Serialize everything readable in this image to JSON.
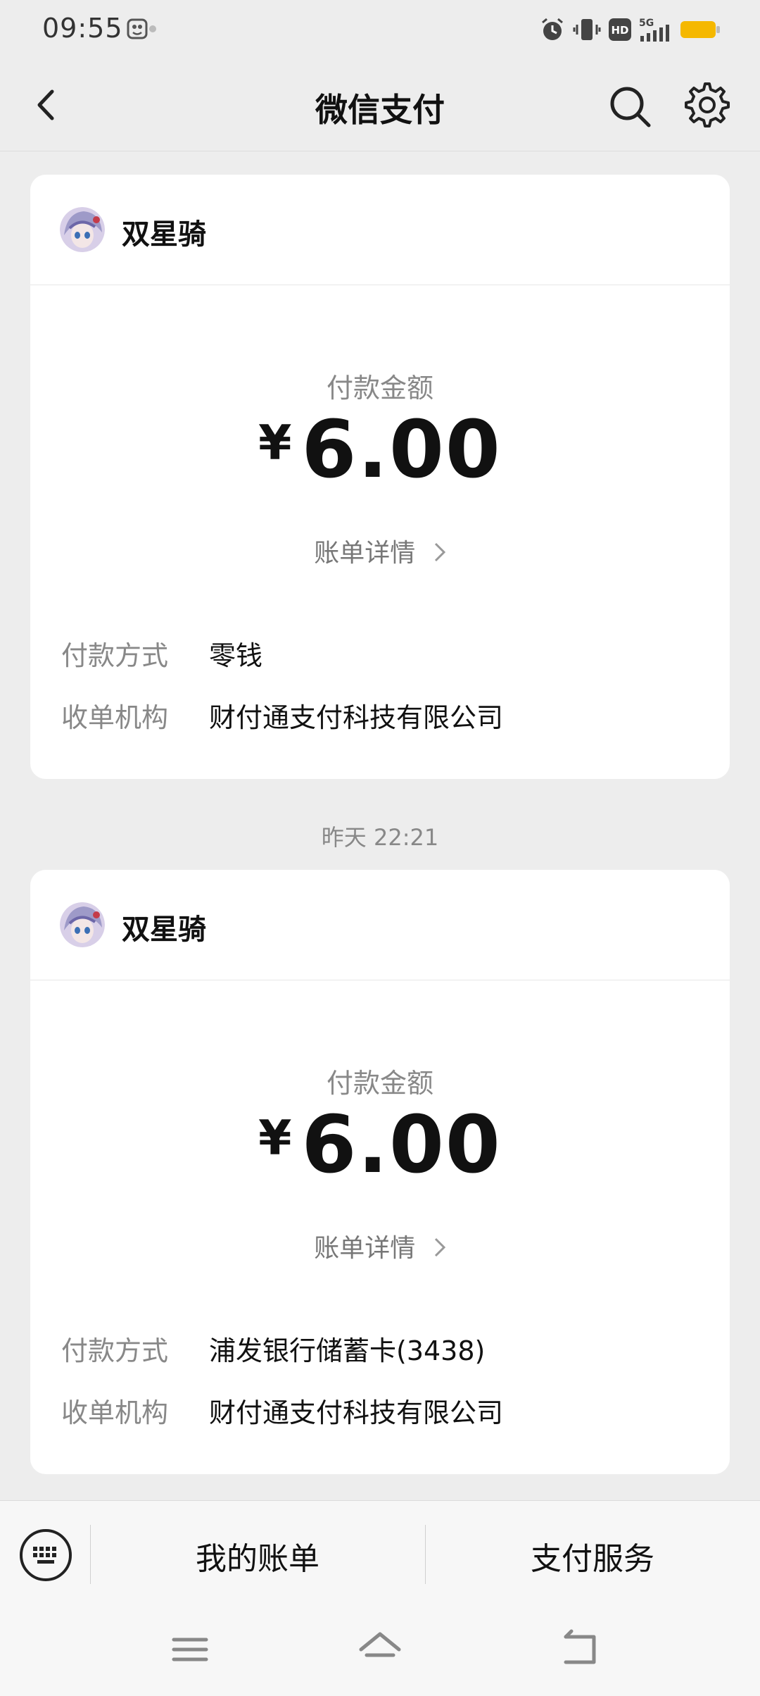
{
  "status_bar": {
    "time": "09:55",
    "network": "5G",
    "hd": "HD"
  },
  "nav": {
    "title": "微信支付"
  },
  "payments": [
    {
      "merchant": "双星骑",
      "amount_label": "付款金额",
      "currency": "¥",
      "amount": "6.00",
      "detail_link": "账单详情",
      "method_label": "付款方式",
      "method_value": "零钱",
      "org_label": "收单机构",
      "org_value": "财付通支付科技有限公司"
    },
    {
      "merchant": "双星骑",
      "amount_label": "付款金额",
      "currency": "¥",
      "amount": "6.00",
      "detail_link": "账单详情",
      "method_label": "付款方式",
      "method_value": "浦发银行储蓄卡(3438)",
      "org_label": "收单机构",
      "org_value": "财付通支付科技有限公司"
    }
  ],
  "timestamp": "昨天  22:21",
  "bottom_bar": {
    "my_bills": "我的账单",
    "pay_services": "支付服务"
  },
  "colors": {
    "background": "#ededed",
    "card": "#ffffff",
    "battery": "#f5b800",
    "muted_text": "#888888"
  }
}
